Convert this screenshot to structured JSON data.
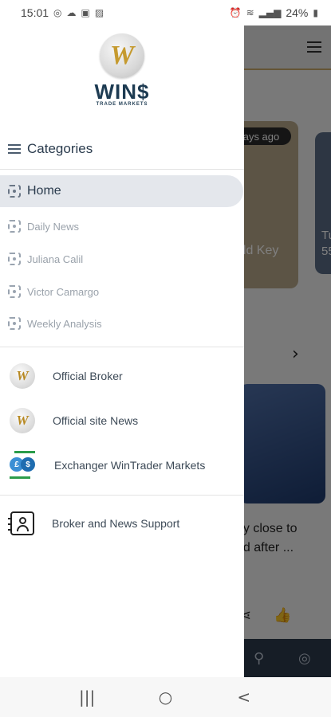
{
  "status_bar": {
    "time": "15:01",
    "battery": "24%",
    "left_icons": [
      "whatsapp-icon",
      "cloud-icon",
      "gallery-icon",
      "image-icon"
    ],
    "right_icons": [
      "alarm-icon",
      "wifi-icon",
      "signal-icon",
      "battery-icon"
    ]
  },
  "drawer": {
    "logo": {
      "text": "WIN$",
      "subtitle": "TRADE MARKETS",
      "mark": "W"
    },
    "categories_label": "Categories",
    "home_label": "Home",
    "sub_items": [
      {
        "label": "Daily News"
      },
      {
        "label": "Juliana Calil"
      },
      {
        "label": "Victor Camargo"
      },
      {
        "label": "Weekly Analysis"
      }
    ],
    "menu_items": [
      {
        "label": "Official Broker",
        "icon": "wins-coin-icon"
      },
      {
        "label": "Official site News",
        "icon": "wins-coin-icon"
      },
      {
        "label": "Exchanger WinTrader Markets",
        "icon": "currency-exchange-icon"
      }
    ],
    "support_label": "Broker and News Support"
  },
  "background": {
    "card1_badge": "ays ago",
    "card1_text": "old Key",
    "card2_text_1": "Tu",
    "card2_text_2": "55",
    "article_line1": "ay close to",
    "article_line2": "nd after ..."
  },
  "sys_nav": {
    "recent": "|||",
    "home": "○",
    "back": "<"
  },
  "colors": {
    "brand_navy": "#1d3b52",
    "brand_gold": "#c59a2f",
    "selected_bg": "#e4e7ec"
  }
}
